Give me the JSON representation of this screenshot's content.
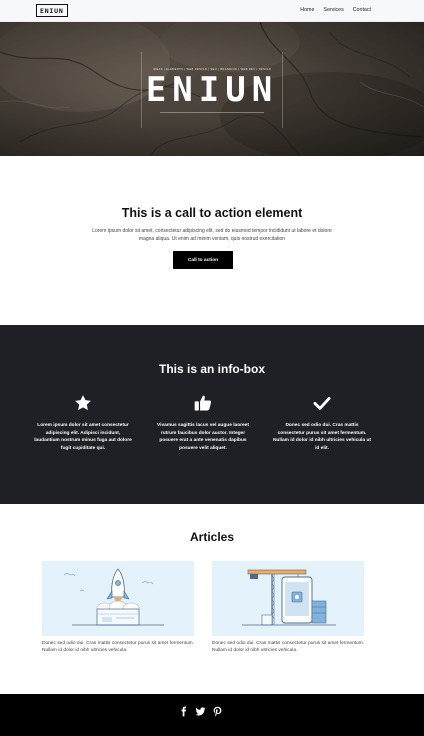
{
  "nav": {
    "logo": "ENIUN",
    "links": [
      "Home",
      "Services",
      "Contact"
    ]
  },
  "hero": {
    "brand": "ENIUN",
    "tagline": "IDEAS | ELEMENTS | WEB DESIGN | SEO | BRANDING | WEB DEV | DESIGN"
  },
  "cta": {
    "title": "This is a call to action element",
    "text": "Lorem ipsum dolor sit amet, consectetur adipiscing elit, sed do eiusmod tempor incididunt ut labore et dolore magna aliqua. Ut enim ad minim veniam, quis nostrud exercitation",
    "button_label": "Call to action"
  },
  "infobox": {
    "title": "This is an info-box",
    "items": [
      {
        "icon": "star-icon",
        "text": "Lorem ipsum dolor sit amet consectetur adipiscing elit. Adipisci incidunt, laudantium nostrum minus fuga aut dolore fugit cupiditate qui."
      },
      {
        "icon": "thumbs-up-icon",
        "text": "Vivamus sagittis lacus vel augue laoreet rutrum faucibus dolor auctor. Integer posuere erat a ante venenatis dapibus posuere velit aliquet."
      },
      {
        "icon": "checkmark-icon",
        "text": "Donec sed odio dui. Cras mattis consectetur purus sit amet fermentum. Nullam id dolor id nibh ultricies vehicula ut id elit."
      }
    ]
  },
  "articles": {
    "title": "Articles",
    "items": [
      {
        "image": "rocket-launch-illustration",
        "text": "Donec sed odio dui. Cras mattis consectetur purus sit amet fermentum. Nullam id dolor id nibh ultricies vehicula."
      },
      {
        "image": "construction-crane-phone-illustration",
        "text": "Donec sed odio dui. Cras mattis consectetur purus sit amet fermentum. Nullam id dolor id nibh ultricies vehicula."
      }
    ]
  },
  "footer": {
    "social": [
      "facebook-icon",
      "twitter-icon",
      "pinterest-icon"
    ]
  },
  "colors": {
    "navbar_bg": "#f7f8fa",
    "infobox_bg": "#1f2026",
    "footer_bg": "#000000",
    "button_bg": "#000000",
    "article_image_bg": "#e3f2fb"
  }
}
